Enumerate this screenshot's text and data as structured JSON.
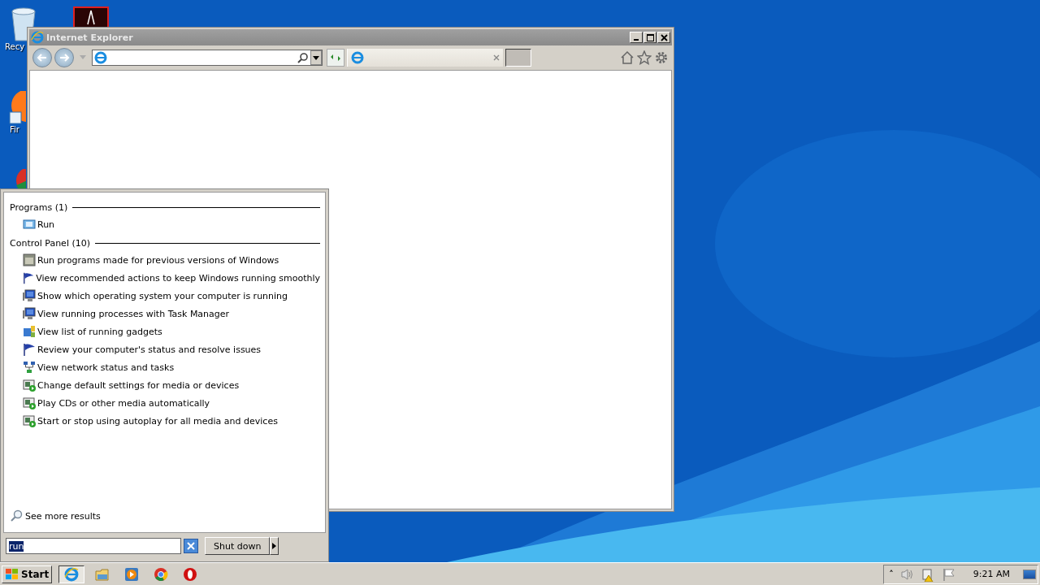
{
  "desktop": {
    "icons": [
      {
        "kind": "recycle",
        "label": "Recy"
      },
      {
        "kind": "pdf"
      },
      {
        "kind": "firefox",
        "label": "Fir"
      },
      {
        "kind": "chrome"
      }
    ]
  },
  "browser": {
    "title": "Internet Explorer"
  },
  "start_menu": {
    "groups": [
      {
        "heading": "Programs (1)",
        "items": [
          {
            "kind": "run",
            "label": "Run"
          }
        ]
      },
      {
        "heading": "Control Panel (10)",
        "items": [
          {
            "kind": "compat",
            "label": "Run programs made for previous versions of Windows"
          },
          {
            "kind": "flag",
            "label": "View recommended actions to keep Windows running smoothly"
          },
          {
            "kind": "monitor",
            "label": "Show which operating system your computer is running"
          },
          {
            "kind": "monitor",
            "label": "View running processes with Task Manager"
          },
          {
            "kind": "gadgets",
            "label": "View list of running gadgets"
          },
          {
            "kind": "flag",
            "label": "Review your computer's status and resolve issues"
          },
          {
            "kind": "network",
            "label": "View network status and tasks"
          },
          {
            "kind": "media",
            "label": "Change default settings for media or devices"
          },
          {
            "kind": "media",
            "label": "Play CDs or other media automatically"
          },
          {
            "kind": "media",
            "label": "Start or stop using autoplay for all media and devices"
          }
        ]
      }
    ],
    "see_more": "See more results",
    "search": {
      "value": "run"
    },
    "shutdown": "Shut down"
  },
  "taskbar": {
    "start": "Start",
    "apps": [
      {
        "kind": "ie",
        "selected": true
      },
      {
        "kind": "folder",
        "selected": false
      },
      {
        "kind": "media",
        "selected": false
      },
      {
        "kind": "chrome",
        "selected": false
      },
      {
        "kind": "opera",
        "selected": false
      }
    ],
    "tray_expand": "˄",
    "clock": "9:21 AM"
  }
}
